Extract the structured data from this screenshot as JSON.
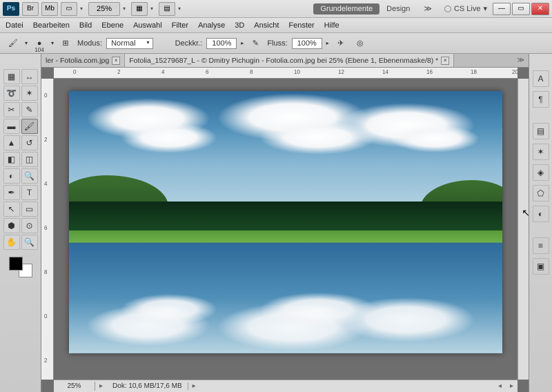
{
  "title_icons": {
    "br": "Br",
    "mb": "Mb"
  },
  "top_zoom": "25%",
  "workspaces": {
    "active": "Grundelemente",
    "other": "Design",
    "more": "≫"
  },
  "cslive": "CS Live",
  "menu": [
    "Datei",
    "Bearbeiten",
    "Bild",
    "Ebene",
    "Auswahl",
    "Filter",
    "Analyse",
    "3D",
    "Ansicht",
    "Fenster",
    "Hilfe"
  ],
  "optionbar": {
    "brush_size": "104",
    "mode_label": "Modus:",
    "mode_value": "Normal",
    "opacity_label": "Deckkr.:",
    "opacity_value": "100%",
    "flow_label": "Fluss:",
    "flow_value": "100%"
  },
  "tabs": {
    "t1": "ler - Fotolia.com.jpg",
    "t2": "Fotolia_15279687_L - © Dmitry Pichugin - Fotolia.com.jpg bei 25% (Ebene 1, Ebenenmaske/8) *"
  },
  "ruler_h": [
    "0",
    "2",
    "4",
    "6",
    "8",
    "10",
    "12",
    "14",
    "16",
    "18",
    "20"
  ],
  "ruler_v": [
    "0",
    "2",
    "4",
    "6",
    "8",
    "0",
    "2"
  ],
  "status": {
    "zoom": "25%",
    "doc": "Dok: 10,6 MB/17,6 MB"
  }
}
